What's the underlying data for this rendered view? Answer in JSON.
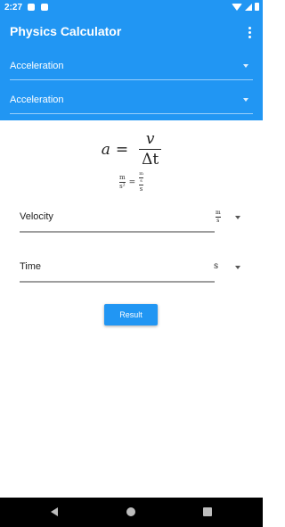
{
  "status_bar": {
    "time": "2:27",
    "icons": [
      "app-notification-icon",
      "app-notification-icon",
      "wifi-icon",
      "signal-icon",
      "battery-icon"
    ]
  },
  "app_bar": {
    "title": "Physics Calculator",
    "menu_icon": "overflow-menu-icon"
  },
  "selectors": [
    {
      "selected": "Acceleration"
    },
    {
      "selected": "Acceleration"
    }
  ],
  "formula": {
    "lhs": "a",
    "equals": "=",
    "numerator": "v",
    "denominator": "Δt"
  },
  "unit_formula": {
    "lhs_num": "m",
    "lhs_den": "s²",
    "equals": "=",
    "rhs_num": "m",
    "rhs_num_den": "s",
    "rhs_den": "s"
  },
  "inputs": [
    {
      "label": "Velocity",
      "unit_num": "m",
      "unit_den": "s"
    },
    {
      "label": "Time",
      "unit": "s"
    }
  ],
  "result_button": {
    "label": "Result"
  },
  "colors": {
    "primary": "#2196f3",
    "nav_bar": "#000000"
  }
}
